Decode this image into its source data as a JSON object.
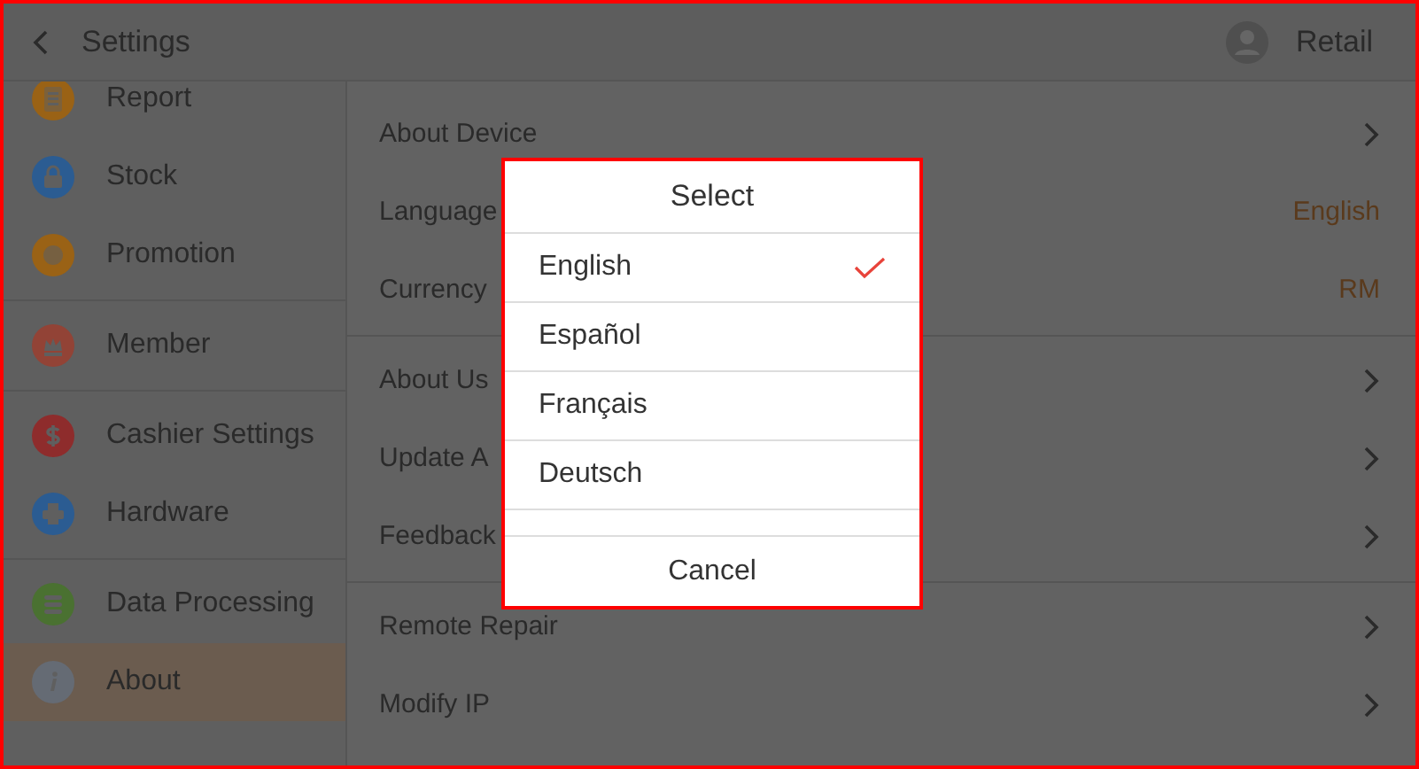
{
  "header": {
    "title": "Settings",
    "user": "Retail"
  },
  "sidebar": {
    "groups": [
      [
        {
          "label": "Report",
          "color": "#9a6215",
          "selected": false
        },
        {
          "label": "Stock",
          "color": "#2b5c92",
          "selected": false
        },
        {
          "label": "Promotion",
          "color": "#9a6215",
          "selected": false
        }
      ],
      [
        {
          "label": "Member",
          "color": "#924336",
          "selected": false
        }
      ],
      [
        {
          "label": "Cashier Settings",
          "color": "#8e2c2c",
          "selected": false
        },
        {
          "label": "Hardware",
          "color": "#2b5c92",
          "selected": false
        }
      ],
      [
        {
          "label": "Data Processing",
          "color": "#4a7131",
          "selected": false
        },
        {
          "label": "About",
          "color": "#656b74",
          "selected": true
        }
      ]
    ]
  },
  "settings": {
    "groups": [
      [
        {
          "label": "About Device",
          "kind": "link"
        },
        {
          "label": "Language",
          "kind": "value",
          "value": "English"
        },
        {
          "label": "Currency",
          "kind": "value",
          "value": "RM"
        }
      ],
      [
        {
          "label": "About Us",
          "kind": "link"
        },
        {
          "label": "Update A",
          "kind": "link"
        },
        {
          "label": "Feedback",
          "kind": "link"
        }
      ],
      [
        {
          "label": "Remote Repair",
          "kind": "link"
        },
        {
          "label": "Modify IP",
          "kind": "link"
        }
      ]
    ]
  },
  "dialog": {
    "title": "Select",
    "options": [
      {
        "label": "English",
        "selected": true
      },
      {
        "label": "Español",
        "selected": false
      },
      {
        "label": "Français",
        "selected": false
      },
      {
        "label": "Deutsch",
        "selected": false
      }
    ],
    "cancel": "Cancel"
  }
}
